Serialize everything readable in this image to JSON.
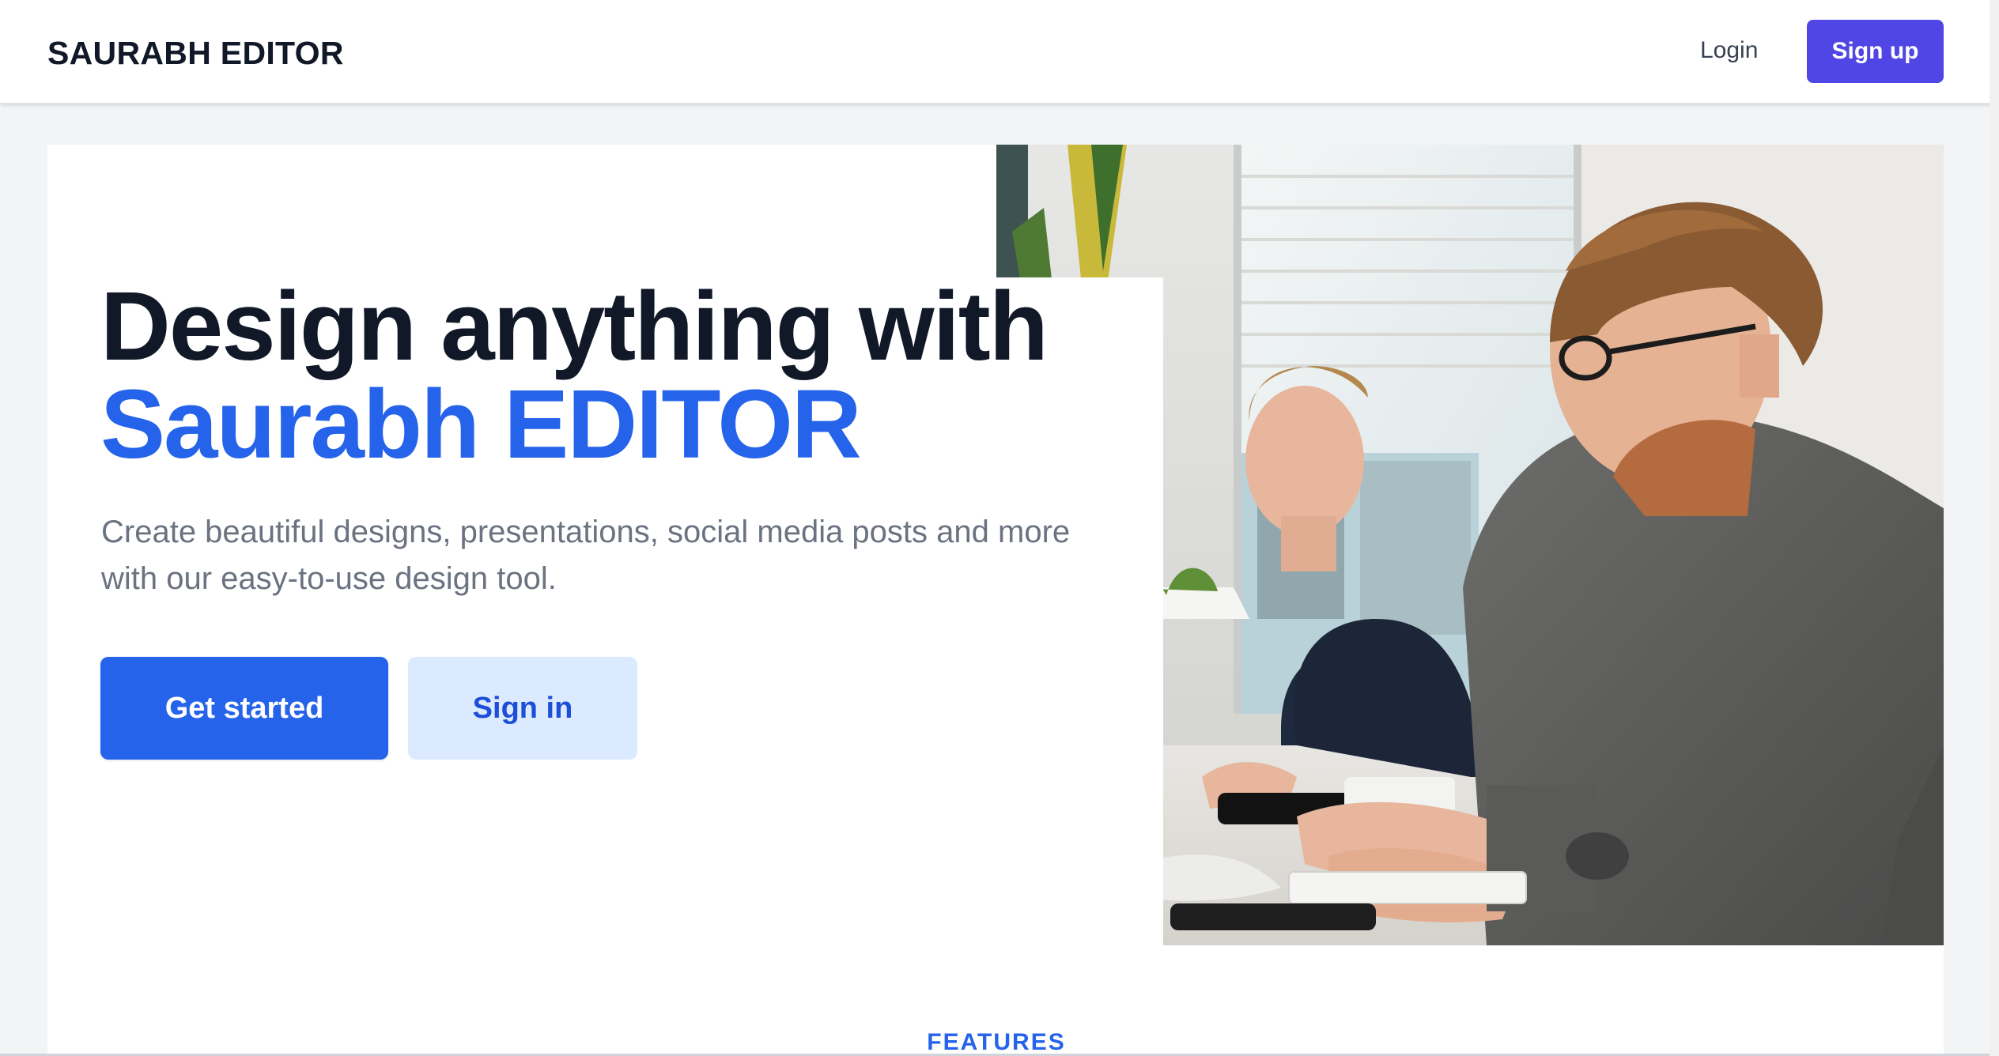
{
  "navbar": {
    "brand": "SAURABH EDITOR",
    "login_label": "Login",
    "signup_label": "Sign up"
  },
  "hero": {
    "headline_line1": "Design anything with",
    "headline_line2": "Saurabh EDITOR",
    "subtext": "Create beautiful designs, presentations, social media posts and more with our easy-to-use design tool.",
    "primary_cta": "Get started",
    "secondary_cta": "Sign in",
    "image_icon": "office-workers-photo"
  },
  "features": {
    "eyebrow": "FEATURES"
  },
  "colors": {
    "accent": "#2563eb",
    "signup_button": "#4f46e5",
    "secondary_button_bg": "#dbeafe",
    "heading": "#111827",
    "body_text": "#6b7280"
  }
}
